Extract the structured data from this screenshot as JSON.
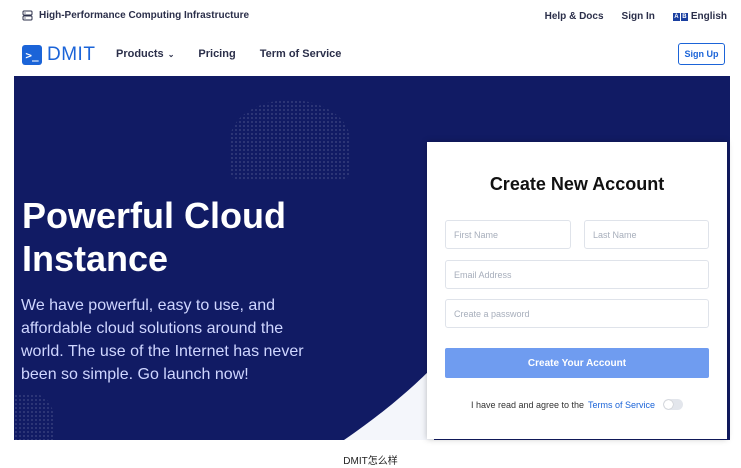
{
  "topbar": {
    "tagline": "High-Performance Computing Infrastructure",
    "links": [
      "Help & Docs",
      "Sign In"
    ],
    "language": "English",
    "language_flag": [
      "A",
      "B"
    ]
  },
  "navbar": {
    "logo_text": "DMIT",
    "logo_glyph": ">_",
    "items": [
      "Products",
      "Pricing",
      "Term of Service"
    ],
    "signup_label": "Sign Up"
  },
  "hero": {
    "title": "Powerful Cloud Instance",
    "description": "We have powerful, easy to use, and affordable cloud solutions around the world. The use of the Internet has never been so simple. Go launch now!"
  },
  "form": {
    "title": "Create New Account",
    "first_name_placeholder": "First Name",
    "last_name_placeholder": "Last Name",
    "email_placeholder": "Email Address",
    "password_placeholder": "Create a password",
    "submit_label": "Create Your Account",
    "agree_text": "I have read and agree to the",
    "agree_link": "Terms of Service",
    "agree_checked": false
  },
  "caption": "DMIT怎么样",
  "colors": {
    "brand": "#1b64d8",
    "hero_bg": "#111b64",
    "button": "#6f9cf0"
  }
}
